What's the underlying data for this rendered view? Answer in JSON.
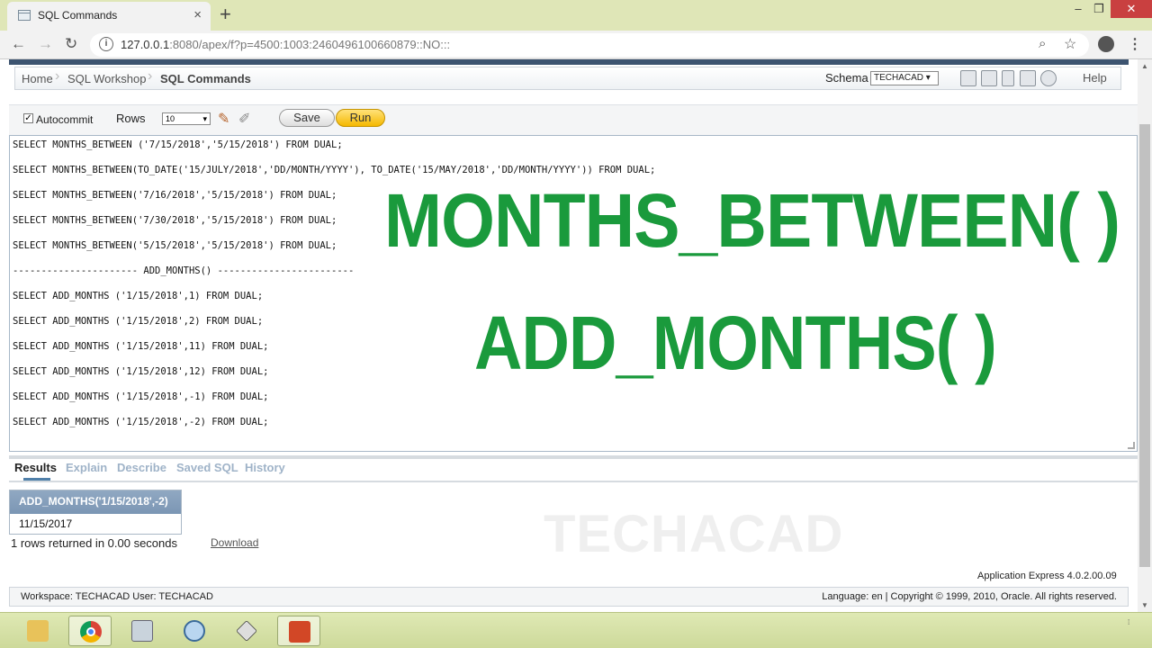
{
  "browser": {
    "tab_title": "SQL Commands",
    "tab_close": "×",
    "new_tab": "+",
    "url_host": "127.0.0.1",
    "url_rest": ":8080/apex/f?p=4500:1003:2460496100660879::NO:::",
    "window_controls": {
      "minimize": "–",
      "maximize": "❐",
      "close": "✕"
    }
  },
  "breadcrumb": {
    "items": [
      "Home",
      "SQL Workshop",
      "SQL Commands"
    ],
    "schema_label": "Schema",
    "schema_value": "TECHACAD",
    "help_label": "Help"
  },
  "toolbar": {
    "autocommit_label": "Autocommit",
    "autocommit_checked": true,
    "rows_label": "Rows",
    "rows_value": "10",
    "save_label": "Save",
    "run_label": "Run"
  },
  "editor": {
    "lines": [
      "SELECT MONTHS_BETWEEN ('7/15/2018','5/15/2018') FROM DUAL;",
      "SELECT MONTHS_BETWEEN(TO_DATE('15/JULY/2018','DD/MONTH/YYYY'), TO_DATE('15/MAY/2018','DD/MONTH/YYYY')) FROM DUAL;",
      "SELECT MONTHS_BETWEEN('7/16/2018','5/15/2018') FROM DUAL;",
      "SELECT MONTHS_BETWEEN('7/30/2018','5/15/2018') FROM DUAL;",
      "SELECT MONTHS_BETWEEN('5/15/2018','5/15/2018') FROM DUAL;",
      "---------------------- ADD_MONTHS() ------------------------",
      "SELECT ADD_MONTHS ('1/15/2018',1) FROM DUAL;",
      "SELECT ADD_MONTHS ('1/15/2018',2) FROM DUAL;",
      "SELECT ADD_MONTHS ('1/15/2018',11) FROM DUAL;",
      "SELECT ADD_MONTHS ('1/15/2018',12) FROM DUAL;",
      "SELECT ADD_MONTHS ('1/15/2018',-1) FROM DUAL;",
      "SELECT ADD_MONTHS ('1/15/2018',-2) FROM DUAL;"
    ],
    "overlay_title_1": "MONTHS_BETWEEN( )",
    "overlay_title_2": "ADD_MONTHS( )",
    "overlay_color": "#1a9a3c"
  },
  "results": {
    "tabs": [
      "Results",
      "Explain",
      "Describe",
      "Saved SQL",
      "History"
    ],
    "active_tab": "Results",
    "column_header": "ADD_MONTHS('1/15/2018',-2)",
    "rows": [
      "11/15/2017"
    ],
    "rows_returned": "1 rows returned in 0.00 seconds",
    "download_label": "Download",
    "watermark": "TECHACAD"
  },
  "footer": {
    "version": "Application Express 4.0.2.00.09",
    "workspace": "Workspace: TECHACAD User: TECHACAD",
    "copyright": "Language: en | Copyright © 1999, 2010, Oracle. All rights reserved."
  },
  "taskbar": {
    "apps": [
      "file-explorer-icon",
      "chrome-icon",
      "files-icon",
      "magnifier-icon",
      "pen-icon",
      "powerpoint-icon"
    ],
    "active_app": "chrome-icon"
  }
}
